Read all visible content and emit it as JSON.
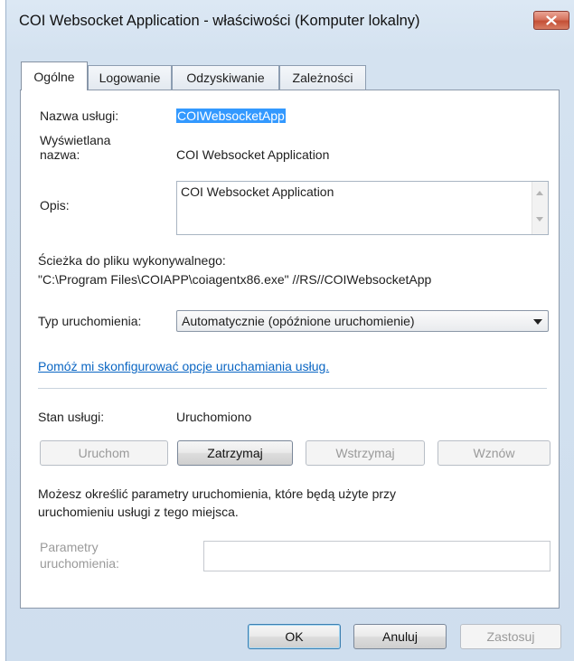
{
  "window": {
    "title": "COI Websocket Application - właściwości (Komputer lokalny)",
    "close_icon": "close-icon"
  },
  "tabs": [
    {
      "label": "Ogólne",
      "active": true
    },
    {
      "label": "Logowanie",
      "active": false
    },
    {
      "label": "Odzyskiwanie",
      "active": false
    },
    {
      "label": "Zależności",
      "active": false
    }
  ],
  "general": {
    "service_name_label": "Nazwa usługi:",
    "service_name_value": "COIWebsocketApp",
    "display_name_label_line1": "Wyświetlana",
    "display_name_label_line2": "nazwa:",
    "display_name_value": "COI Websocket Application",
    "description_label": "Opis:",
    "description_value": "COI Websocket Application",
    "path_label": "Ścieżka do pliku wykonywalnego:",
    "path_value": "\"C:\\Program Files\\COIAPP\\coiagentx86.exe\" //RS//COIWebsocketApp",
    "startup_type_label": "Typ uruchomienia:",
    "startup_type_value": "Automatycznie (opóźnione uruchomienie)",
    "help_link": "Pomóż mi skonfigurować opcje uruchamiania usług.",
    "status_label": "Stan usługi:",
    "status_value": "Uruchomiono",
    "buttons": {
      "start": "Uruchom",
      "stop": "Zatrzymaj",
      "pause": "Wstrzymaj",
      "resume": "Wznów"
    },
    "params_note_line1": "Możesz określić parametry uruchomienia, które będą użyte przy",
    "params_note_line2": "uruchomieniu usługi z tego miejsca.",
    "params_label_line1": "Parametry",
    "params_label_line2": "uruchomienia:",
    "params_value": ""
  },
  "footer": {
    "ok": "OK",
    "cancel": "Anuluj",
    "apply": "Zastosuj"
  },
  "colors": {
    "selection": "#3399ff",
    "link": "#0b66c3",
    "close_button": "#c44f35"
  }
}
